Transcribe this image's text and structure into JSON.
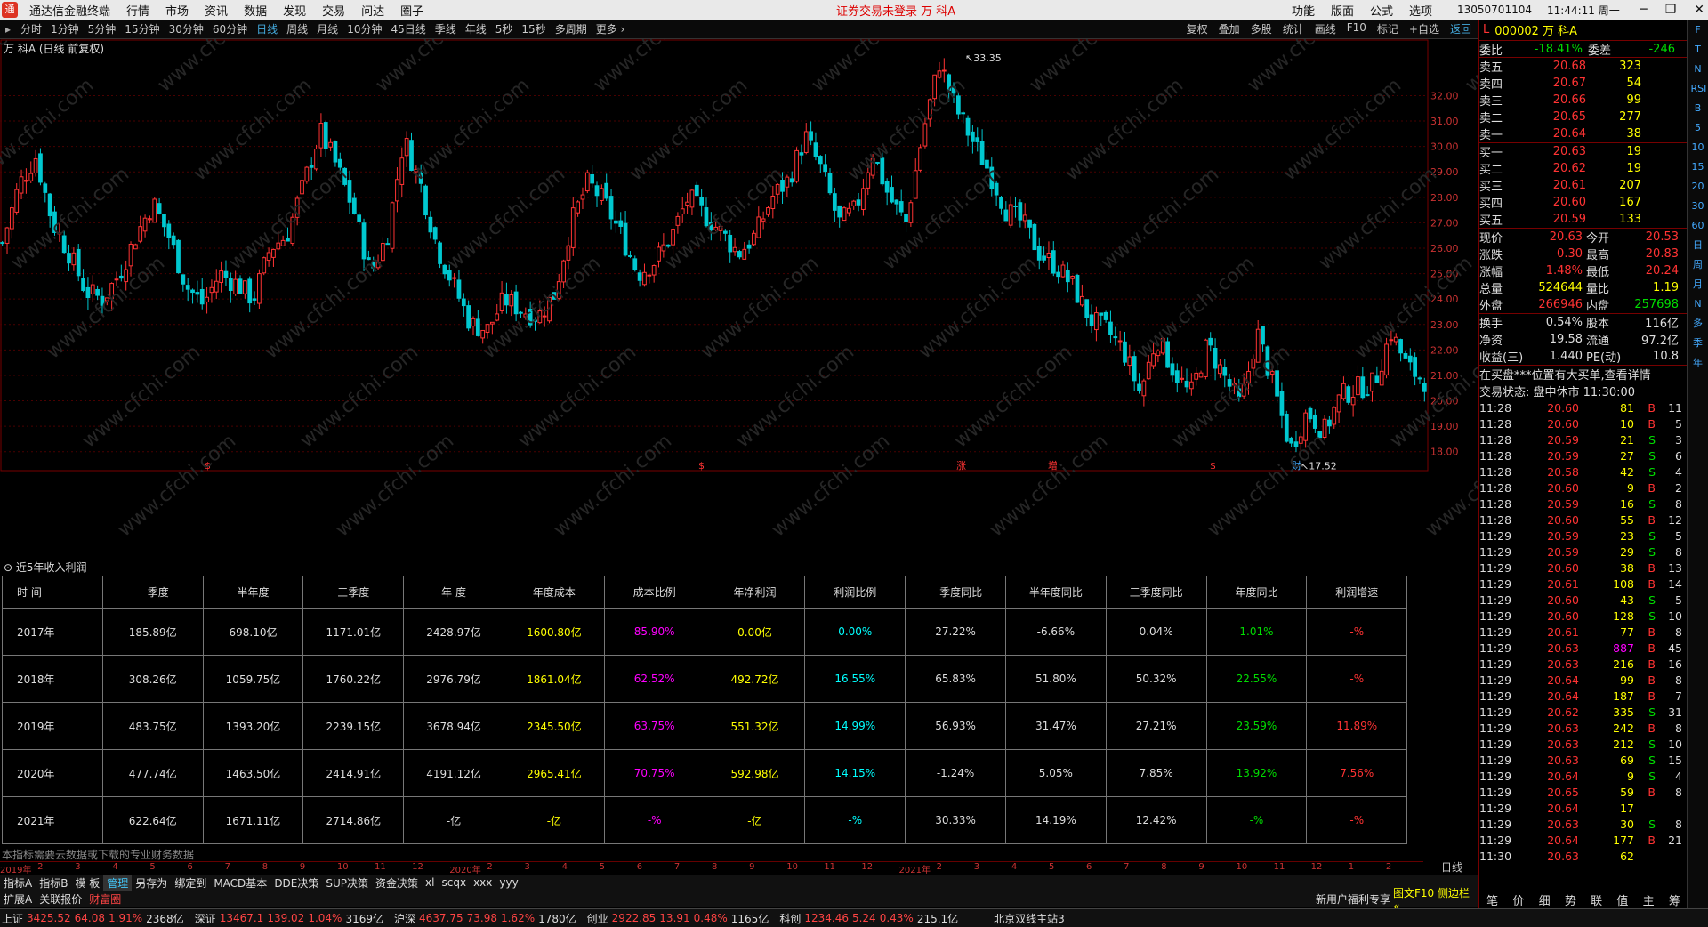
{
  "titlebar": {
    "app": "通达信金融终端",
    "menus": [
      "行情",
      "市场",
      "资讯",
      "数据",
      "发现",
      "交易",
      "问达",
      "圈子"
    ],
    "center": "证券交易未登录 万 科A",
    "right_menus": [
      "功能",
      "版面",
      "公式",
      "选项"
    ],
    "account": "13050701104",
    "clock": "11:44:11 周一"
  },
  "periods": [
    "分时",
    "1分钟",
    "5分钟",
    "15分钟",
    "30分钟",
    "60分钟",
    "日线",
    "周线",
    "月线",
    "10分钟",
    "45日线",
    "季线",
    "年线",
    "5秒",
    "15秒",
    "多周期",
    "更多 ›"
  ],
  "active_period": "日线",
  "chart_tools": [
    "复权",
    "叠加",
    "多股",
    "统计",
    "画线",
    "F10",
    "标记",
    "+自选",
    "返回"
  ],
  "chart_title": "万 科A (日线 前复权)",
  "chart_data": {
    "type": "candlestick",
    "ylim": [
      17.5,
      33.8
    ],
    "yticks": [
      "32.00",
      "31.00",
      "30.00",
      "29.00",
      "28.00",
      "27.00",
      "26.00",
      "25.00",
      "24.00",
      "23.00",
      "22.00",
      "21.00",
      "20.00",
      "19.00",
      "18.00"
    ],
    "high_label": "33.35",
    "low_label": "17.52",
    "event_markers": [
      "$",
      "$",
      "涨",
      "增",
      "$",
      "财"
    ],
    "closes": [
      26.2,
      28.5,
      29.6,
      27.0,
      25.8,
      24.3,
      24.0,
      25.0,
      26.5,
      27.8,
      26.4,
      24.5,
      23.8,
      25.0,
      24.6,
      24.0,
      26.0,
      26.5,
      28.5,
      30.6,
      29.2,
      27.5,
      25.0,
      26.5,
      30.3,
      28.5,
      26.0,
      24.5,
      23.0,
      22.8,
      24.0,
      23.6,
      23.3,
      24.2,
      27.0,
      28.6,
      27.8,
      26.5,
      25.0,
      25.5,
      26.5,
      28.0,
      27.3,
      26.6,
      25.8,
      26.5,
      28.0,
      28.7,
      30.4,
      29.0,
      27.0,
      27.5,
      29.8,
      28.0,
      27.0,
      30.5,
      33.3,
      31.5,
      30.2,
      29.0,
      27.5,
      27.0,
      25.8,
      25.3,
      24.5,
      23.2,
      22.8,
      22.0,
      20.3,
      22.5,
      21.2,
      20.2,
      22.2,
      21.0,
      19.8,
      22.7,
      20.5,
      18.1,
      19.6,
      18.8,
      20.2,
      20.5,
      20.7,
      22.7,
      21.3,
      20.8
    ]
  },
  "table": {
    "header": "近5年收入利润",
    "columns": [
      "时 间",
      "一季度",
      "半年度",
      "三季度",
      "年 度",
      "年度成本",
      "成本比例",
      "年净利润",
      "利润比例",
      "一季度同比",
      "半年度同比",
      "三季度同比",
      "年度同比",
      "利润增速"
    ],
    "rows": [
      [
        "2017年",
        "185.89亿",
        "698.10亿",
        "1171.01亿",
        "2428.97亿",
        "1600.80亿",
        "85.90%",
        "0.00亿",
        "0.00%",
        "27.22%",
        "-6.66%",
        "0.04%",
        "1.01%",
        "-%"
      ],
      [
        "2018年",
        "308.26亿",
        "1059.75亿",
        "1760.22亿",
        "2976.79亿",
        "1861.04亿",
        "62.52%",
        "492.72亿",
        "16.55%",
        "65.83%",
        "51.80%",
        "50.32%",
        "22.55%",
        "-%"
      ],
      [
        "2019年",
        "483.75亿",
        "1393.20亿",
        "2239.15亿",
        "3678.94亿",
        "2345.50亿",
        "63.75%",
        "551.32亿",
        "14.99%",
        "56.93%",
        "31.47%",
        "27.21%",
        "23.59%",
        "11.89%"
      ],
      [
        "2020年",
        "477.74亿",
        "1463.50亿",
        "2414.91亿",
        "4191.12亿",
        "2965.41亿",
        "70.75%",
        "592.98亿",
        "14.15%",
        "-1.24%",
        "5.05%",
        "7.85%",
        "13.92%",
        "7.56%"
      ],
      [
        "2021年",
        "622.64亿",
        "1671.11亿",
        "2714.86亿",
        "-亿",
        "-亿",
        "-%",
        "-亿",
        "-%",
        "30.33%",
        "14.19%",
        "12.42%",
        "-%",
        "-%"
      ]
    ],
    "note": "本指标需要云数据或下载的专业财务数据"
  },
  "datebar": [
    "2019年",
    "2",
    "3",
    "4",
    "5",
    "6",
    "7",
    "8",
    "9",
    "10",
    "11",
    "12",
    "2020年",
    "2",
    "3",
    "4",
    "5",
    "6",
    "7",
    "8",
    "9",
    "10",
    "11",
    "12",
    "2021年",
    "2",
    "3",
    "4",
    "5",
    "6",
    "7",
    "8",
    "9",
    "10",
    "11",
    "12",
    "1",
    "2"
  ],
  "day_button": "日线",
  "indicator_tabs": [
    "指标A",
    "指标B",
    "模 板",
    "管理",
    "另存为",
    "绑定到",
    "MACD基本",
    "DDE决策",
    "SUP决策",
    "资金决策",
    "xl",
    "scqx",
    "xxx",
    "yyy"
  ],
  "sub_tabs": [
    "扩展A",
    "关联报价",
    "财富圈"
  ],
  "sub_news": "新用户福利专享",
  "sub_f10": "图文F10 侧边栏 «",
  "status": {
    "items": [
      {
        "name": "上证",
        "price": "3425.52",
        "chg": "64.08",
        "pct": "1.91%",
        "vol": "2368亿"
      },
      {
        "name": "深证",
        "price": "13467.1",
        "chg": "139.02",
        "pct": "1.04%",
        "vol": "3169亿"
      },
      {
        "name": "沪深",
        "price": "4637.75",
        "chg": "73.98",
        "pct": "1.62%",
        "vol": "1780亿"
      },
      {
        "name": "创业",
        "price": "2922.85",
        "chg": "13.91",
        "pct": "0.48%",
        "vol": "1165亿"
      },
      {
        "name": "科创",
        "price": "1234.46",
        "chg": "5.24",
        "pct": "0.43%",
        "vol": "215.1亿"
      }
    ],
    "server": "北京双线主站3"
  },
  "quote": {
    "code": "000002 万 科A",
    "webi": {
      "k": "委比",
      "v": "-18.41%",
      "k2": "委差",
      "v2": "-246"
    },
    "asks": [
      [
        "卖五",
        "20.68",
        "323"
      ],
      [
        "卖四",
        "20.67",
        "54"
      ],
      [
        "卖三",
        "20.66",
        "99"
      ],
      [
        "卖二",
        "20.65",
        "277"
      ],
      [
        "卖一",
        "20.64",
        "38"
      ]
    ],
    "bids": [
      [
        "买一",
        "20.63",
        "19"
      ],
      [
        "买二",
        "20.62",
        "19"
      ],
      [
        "买三",
        "20.61",
        "207"
      ],
      [
        "买四",
        "20.60",
        "167"
      ],
      [
        "买五",
        "20.59",
        "133"
      ]
    ],
    "stats": [
      [
        "现价",
        "20.63",
        "今开",
        "20.53"
      ],
      [
        "涨跌",
        "0.30",
        "最高",
        "20.83"
      ],
      [
        "涨幅",
        "1.48%",
        "最低",
        "20.24"
      ],
      [
        "总量",
        "524644",
        "量比",
        "1.19"
      ],
      [
        "外盘",
        "266946",
        "内盘",
        "257698"
      ]
    ],
    "stats2": [
      [
        "换手",
        "0.54%",
        "股本",
        "116亿"
      ],
      [
        "净资",
        "19.58",
        "流通",
        "97.2亿"
      ],
      [
        "收益(三)",
        "1.440",
        "PE(动)",
        "10.8"
      ]
    ],
    "msg1": "在买盘***位置有大买单,查看详情",
    "msg2": "交易状态: 盘中休市 11:30:00",
    "ticks": [
      [
        "11:28",
        "20.60",
        "81",
        "B",
        "11"
      ],
      [
        "11:28",
        "20.60",
        "10",
        "B",
        "5"
      ],
      [
        "11:28",
        "20.59",
        "21",
        "S",
        "3"
      ],
      [
        "11:28",
        "20.59",
        "27",
        "S",
        "6"
      ],
      [
        "11:28",
        "20.58",
        "42",
        "S",
        "4"
      ],
      [
        "11:28",
        "20.60",
        "9",
        "B",
        "2"
      ],
      [
        "11:28",
        "20.59",
        "16",
        "S",
        "8"
      ],
      [
        "11:28",
        "20.60",
        "55",
        "B",
        "12"
      ],
      [
        "11:29",
        "20.59",
        "23",
        "S",
        "5"
      ],
      [
        "11:29",
        "20.59",
        "29",
        "S",
        "8"
      ],
      [
        "11:29",
        "20.60",
        "38",
        "B",
        "13"
      ],
      [
        "11:29",
        "20.61",
        "108",
        "B",
        "14"
      ],
      [
        "11:29",
        "20.60",
        "43",
        "S",
        "5"
      ],
      [
        "11:29",
        "20.60",
        "128",
        "S",
        "10"
      ],
      [
        "11:29",
        "20.61",
        "77",
        "B",
        "8"
      ],
      [
        "11:29",
        "20.63",
        "887",
        "B",
        "45"
      ],
      [
        "11:29",
        "20.63",
        "216",
        "B",
        "16"
      ],
      [
        "11:29",
        "20.64",
        "99",
        "B",
        "8"
      ],
      [
        "11:29",
        "20.64",
        "187",
        "B",
        "7"
      ],
      [
        "11:29",
        "20.62",
        "335",
        "S",
        "31"
      ],
      [
        "11:29",
        "20.63",
        "242",
        "B",
        "8"
      ],
      [
        "11:29",
        "20.63",
        "212",
        "S",
        "10"
      ],
      [
        "11:29",
        "20.63",
        "69",
        "S",
        "15"
      ],
      [
        "11:29",
        "20.64",
        "9",
        "S",
        "4"
      ],
      [
        "11:29",
        "20.65",
        "59",
        "B",
        "8"
      ],
      [
        "11:29",
        "20.64",
        "17",
        "",
        ""
      ],
      [
        "11:29",
        "20.63",
        "30",
        "S",
        "8"
      ],
      [
        "11:29",
        "20.64",
        "177",
        "B",
        "21"
      ],
      [
        "11:30",
        "20.63",
        "62",
        "",
        ""
      ]
    ],
    "tabs": [
      "笔",
      "价",
      "细",
      "势",
      "联",
      "值",
      "主",
      "筹"
    ]
  },
  "side_icons": [
    "side-icon-1",
    "side-icon-2",
    "side-icon-3"
  ],
  "side_letters": [
    "F",
    "T",
    "N",
    "RSI",
    "B",
    "5",
    "10",
    "15",
    "20",
    "30",
    "60",
    "日",
    "周",
    "月",
    "N",
    "多",
    "季",
    "年"
  ]
}
